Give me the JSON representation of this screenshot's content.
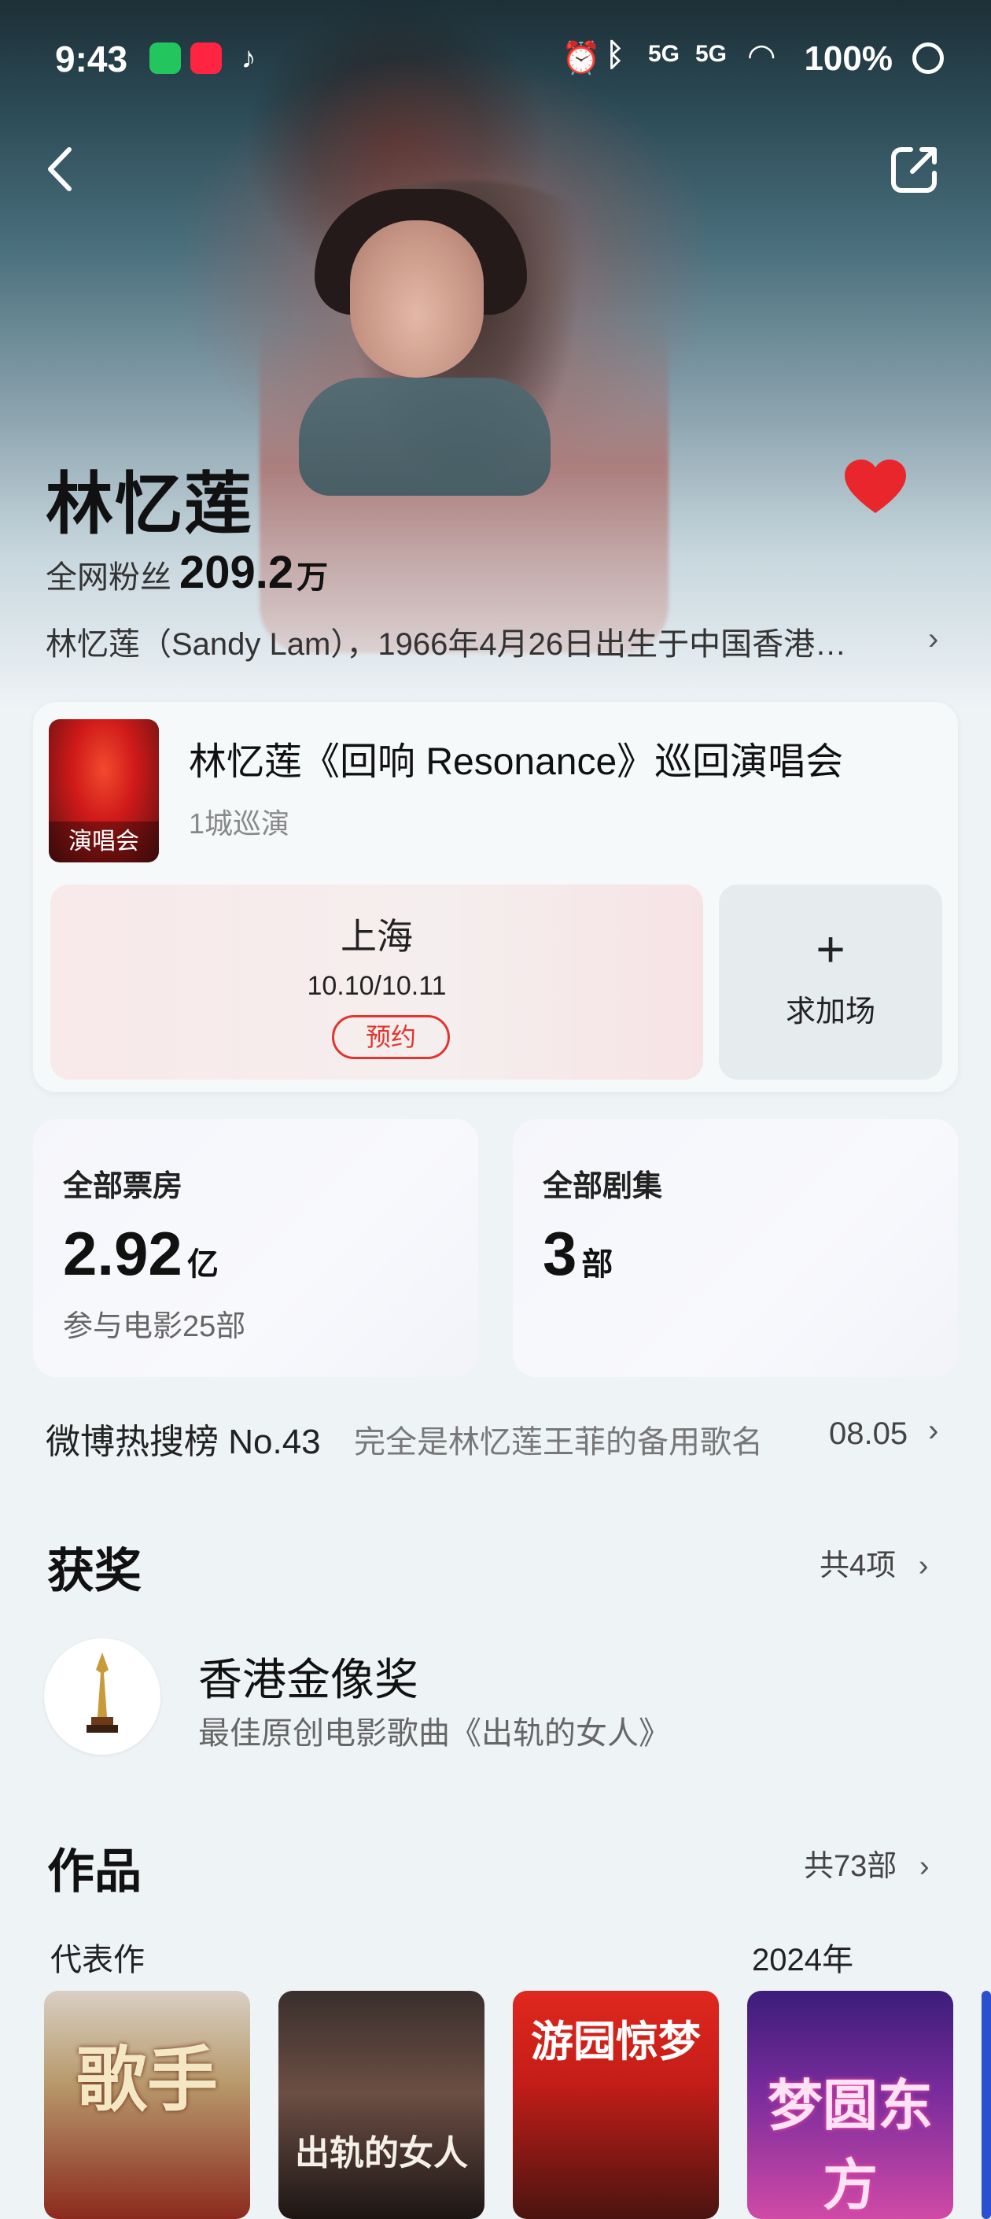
{
  "status_bar": {
    "time": "9:43",
    "battery_pct": "100%",
    "network": "5G"
  },
  "header": {
    "back_icon": "chevron-left-icon",
    "share_icon": "share-icon"
  },
  "artist": {
    "name": "林忆莲",
    "fans_label": "全网粉丝",
    "fans_value": "209.2",
    "fans_unit": "万",
    "bio": "林忆莲（Sandy Lam），1966年4月26日出生于中国香港…",
    "favorite_color": "#e8262b"
  },
  "concert": {
    "poster_label": "演唱会",
    "title": "林忆莲《回响 Resonance》巡回演唱会",
    "subtitle": "1城巡演",
    "city": "上海",
    "dates": "10.10/10.11",
    "book_label": "预约",
    "add_label": "求加场",
    "accent_color": "#e0362e"
  },
  "stats": [
    {
      "label": "全部票房",
      "value": "2.92",
      "unit": "亿",
      "sub": "参与电影25部"
    },
    {
      "label": "全部剧集",
      "value": "3",
      "unit": "部",
      "sub": ""
    }
  ],
  "hot_search": {
    "rank": "微博热搜榜 No.43",
    "topic": "完全是林忆莲王菲的备用歌名",
    "date": "08.05"
  },
  "awards": {
    "title": "获奖",
    "count": "共4项",
    "item": {
      "name": "香港金像奖",
      "desc": "最佳原创电影歌曲《出轨的女人》"
    }
  },
  "works": {
    "title": "作品",
    "count": "共73部",
    "representative_label": "代表作",
    "year_label": "2024年",
    "items": [
      {
        "name": "歌手"
      },
      {
        "name": "出轨的女人"
      },
      {
        "name": "游园惊梦"
      },
      {
        "name": "梦圆东方"
      }
    ]
  }
}
